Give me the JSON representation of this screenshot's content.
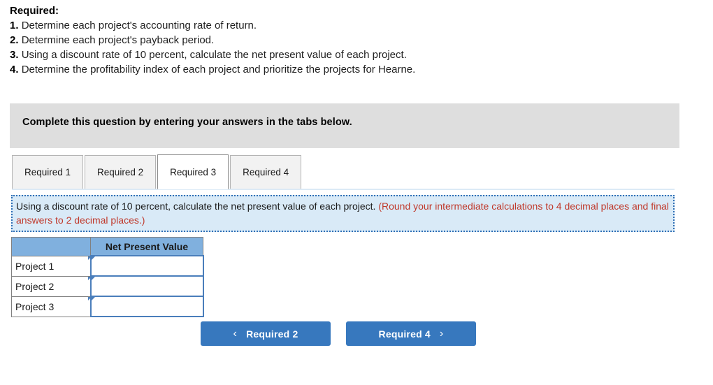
{
  "required": {
    "heading": "Required:",
    "items": [
      {
        "num": "1.",
        "text": "Determine each project's accounting rate of return."
      },
      {
        "num": "2.",
        "text": "Determine each project's payback period."
      },
      {
        "num": "3.",
        "text": "Using a discount rate of 10 percent, calculate the net present value of each project."
      },
      {
        "num": "4.",
        "text": "Determine the profitability index of each project and prioritize the projects for Hearne."
      }
    ]
  },
  "banner": {
    "text": "Complete this question by entering your answers in the tabs below."
  },
  "tabs": {
    "items": [
      {
        "label": "Required 1",
        "active": false
      },
      {
        "label": "Required 2",
        "active": false
      },
      {
        "label": "Required 3",
        "active": true
      },
      {
        "label": "Required 4",
        "active": false
      }
    ]
  },
  "instruction": {
    "main": "Using a discount rate of 10 percent, calculate the net present value of each project.",
    "note": "(Round your intermediate calculations to 4 decimal places and final answers to 2 decimal places.)"
  },
  "table": {
    "header_blank": "",
    "header_value": "Net Present Value",
    "rows": [
      {
        "label": "Project 1",
        "value": ""
      },
      {
        "label": "Project 2",
        "value": ""
      },
      {
        "label": "Project 3",
        "value": ""
      }
    ]
  },
  "nav": {
    "prev_label": "Required 2",
    "prev_icon": "chevron-left",
    "next_label": "Required 4",
    "next_icon": "chevron-right"
  },
  "colors": {
    "banner_gray": "#dedede",
    "table_header_blue": "#80b0de",
    "input_border_blue": "#4a7ebb",
    "instruction_bg": "#d9eaf7",
    "button_blue": "#3778be",
    "note_red": "#c0392b"
  }
}
